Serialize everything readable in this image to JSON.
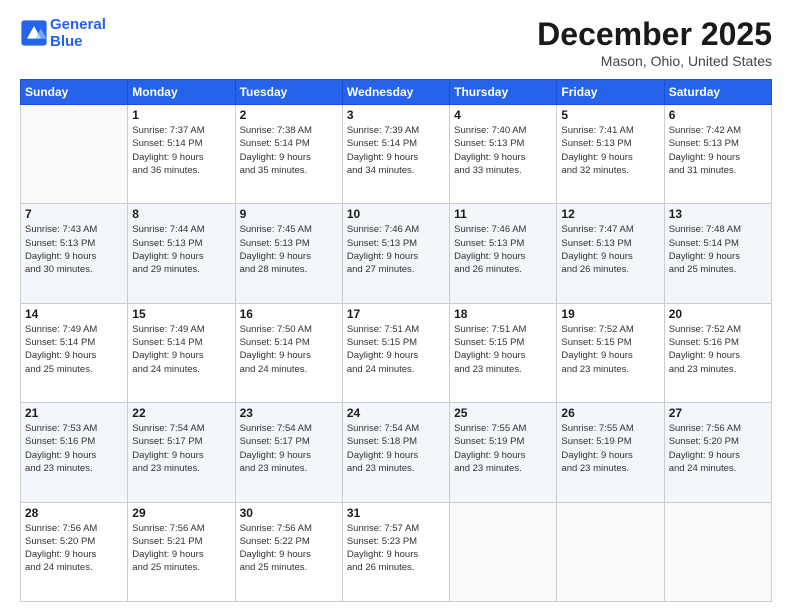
{
  "header": {
    "logo_line1": "General",
    "logo_line2": "Blue",
    "month": "December 2025",
    "location": "Mason, Ohio, United States"
  },
  "weekdays": [
    "Sunday",
    "Monday",
    "Tuesday",
    "Wednesday",
    "Thursday",
    "Friday",
    "Saturday"
  ],
  "weeks": [
    [
      {
        "day": "",
        "info": ""
      },
      {
        "day": "1",
        "info": "Sunrise: 7:37 AM\nSunset: 5:14 PM\nDaylight: 9 hours\nand 36 minutes."
      },
      {
        "day": "2",
        "info": "Sunrise: 7:38 AM\nSunset: 5:14 PM\nDaylight: 9 hours\nand 35 minutes."
      },
      {
        "day": "3",
        "info": "Sunrise: 7:39 AM\nSunset: 5:14 PM\nDaylight: 9 hours\nand 34 minutes."
      },
      {
        "day": "4",
        "info": "Sunrise: 7:40 AM\nSunset: 5:13 PM\nDaylight: 9 hours\nand 33 minutes."
      },
      {
        "day": "5",
        "info": "Sunrise: 7:41 AM\nSunset: 5:13 PM\nDaylight: 9 hours\nand 32 minutes."
      },
      {
        "day": "6",
        "info": "Sunrise: 7:42 AM\nSunset: 5:13 PM\nDaylight: 9 hours\nand 31 minutes."
      }
    ],
    [
      {
        "day": "7",
        "info": "Sunrise: 7:43 AM\nSunset: 5:13 PM\nDaylight: 9 hours\nand 30 minutes."
      },
      {
        "day": "8",
        "info": "Sunrise: 7:44 AM\nSunset: 5:13 PM\nDaylight: 9 hours\nand 29 minutes."
      },
      {
        "day": "9",
        "info": "Sunrise: 7:45 AM\nSunset: 5:13 PM\nDaylight: 9 hours\nand 28 minutes."
      },
      {
        "day": "10",
        "info": "Sunrise: 7:46 AM\nSunset: 5:13 PM\nDaylight: 9 hours\nand 27 minutes."
      },
      {
        "day": "11",
        "info": "Sunrise: 7:46 AM\nSunset: 5:13 PM\nDaylight: 9 hours\nand 26 minutes."
      },
      {
        "day": "12",
        "info": "Sunrise: 7:47 AM\nSunset: 5:13 PM\nDaylight: 9 hours\nand 26 minutes."
      },
      {
        "day": "13",
        "info": "Sunrise: 7:48 AM\nSunset: 5:14 PM\nDaylight: 9 hours\nand 25 minutes."
      }
    ],
    [
      {
        "day": "14",
        "info": "Sunrise: 7:49 AM\nSunset: 5:14 PM\nDaylight: 9 hours\nand 25 minutes."
      },
      {
        "day": "15",
        "info": "Sunrise: 7:49 AM\nSunset: 5:14 PM\nDaylight: 9 hours\nand 24 minutes."
      },
      {
        "day": "16",
        "info": "Sunrise: 7:50 AM\nSunset: 5:14 PM\nDaylight: 9 hours\nand 24 minutes."
      },
      {
        "day": "17",
        "info": "Sunrise: 7:51 AM\nSunset: 5:15 PM\nDaylight: 9 hours\nand 24 minutes."
      },
      {
        "day": "18",
        "info": "Sunrise: 7:51 AM\nSunset: 5:15 PM\nDaylight: 9 hours\nand 23 minutes."
      },
      {
        "day": "19",
        "info": "Sunrise: 7:52 AM\nSunset: 5:15 PM\nDaylight: 9 hours\nand 23 minutes."
      },
      {
        "day": "20",
        "info": "Sunrise: 7:52 AM\nSunset: 5:16 PM\nDaylight: 9 hours\nand 23 minutes."
      }
    ],
    [
      {
        "day": "21",
        "info": "Sunrise: 7:53 AM\nSunset: 5:16 PM\nDaylight: 9 hours\nand 23 minutes."
      },
      {
        "day": "22",
        "info": "Sunrise: 7:54 AM\nSunset: 5:17 PM\nDaylight: 9 hours\nand 23 minutes."
      },
      {
        "day": "23",
        "info": "Sunrise: 7:54 AM\nSunset: 5:17 PM\nDaylight: 9 hours\nand 23 minutes."
      },
      {
        "day": "24",
        "info": "Sunrise: 7:54 AM\nSunset: 5:18 PM\nDaylight: 9 hours\nand 23 minutes."
      },
      {
        "day": "25",
        "info": "Sunrise: 7:55 AM\nSunset: 5:19 PM\nDaylight: 9 hours\nand 23 minutes."
      },
      {
        "day": "26",
        "info": "Sunrise: 7:55 AM\nSunset: 5:19 PM\nDaylight: 9 hours\nand 23 minutes."
      },
      {
        "day": "27",
        "info": "Sunrise: 7:56 AM\nSunset: 5:20 PM\nDaylight: 9 hours\nand 24 minutes."
      }
    ],
    [
      {
        "day": "28",
        "info": "Sunrise: 7:56 AM\nSunset: 5:20 PM\nDaylight: 9 hours\nand 24 minutes."
      },
      {
        "day": "29",
        "info": "Sunrise: 7:56 AM\nSunset: 5:21 PM\nDaylight: 9 hours\nand 25 minutes."
      },
      {
        "day": "30",
        "info": "Sunrise: 7:56 AM\nSunset: 5:22 PM\nDaylight: 9 hours\nand 25 minutes."
      },
      {
        "day": "31",
        "info": "Sunrise: 7:57 AM\nSunset: 5:23 PM\nDaylight: 9 hours\nand 26 minutes."
      },
      {
        "day": "",
        "info": ""
      },
      {
        "day": "",
        "info": ""
      },
      {
        "day": "",
        "info": ""
      }
    ]
  ]
}
